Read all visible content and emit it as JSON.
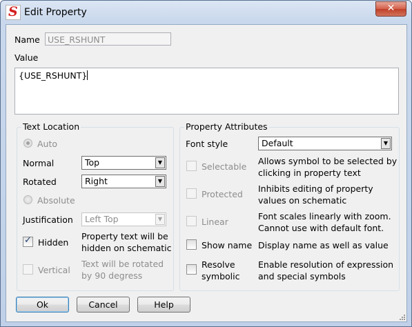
{
  "window": {
    "title": "Edit Property",
    "close_glyph": "✕"
  },
  "name_field": {
    "label": "Name",
    "value": "USE_RSHUNT"
  },
  "value_field": {
    "label": "Value",
    "value": "{USE_RSHUNT}"
  },
  "text_location": {
    "title": "Text Location",
    "auto_label": "Auto",
    "normal_label": "Normal",
    "normal_value": "Top",
    "rotated_label": "Rotated",
    "rotated_value": "Right",
    "absolute_label": "Absolute",
    "justification_label": "Justification",
    "justification_value": "Left Top",
    "hidden_label": "Hidden",
    "hidden_checked": true,
    "hidden_desc": [
      "Property text will be",
      "hidden on schematic"
    ],
    "vertical_label": "Vertical",
    "vertical_desc": [
      "Text will be rotated",
      "by 90 degress"
    ]
  },
  "property_attributes": {
    "title": "Property Attributes",
    "font_style_label": "Font style",
    "font_style_value": "Default",
    "selectable_label": "Selectable",
    "selectable_desc": [
      "Allows symbol to be selected by",
      "clicking in property text"
    ],
    "protected_label": "Protected",
    "protected_desc": [
      "Inhibits editing of property",
      "values on schematic"
    ],
    "linear_label": "Linear",
    "linear_desc": [
      "Font scales linearly with zoom.",
      "Cannot use with default font."
    ],
    "show_name_label": "Show name",
    "show_name_desc": "Display name as well as value",
    "resolve_label": [
      "Resolve",
      "symbolic"
    ],
    "resolve_desc": [
      "Enable resolution of expression",
      "and special symbols"
    ]
  },
  "buttons": {
    "ok": "Ok",
    "cancel": "Cancel",
    "help": "Help"
  },
  "icons": {
    "app": "simetrix-logo-icon",
    "dropdown": "▼",
    "check": "✓",
    "grip": "resize-grip-icon"
  }
}
